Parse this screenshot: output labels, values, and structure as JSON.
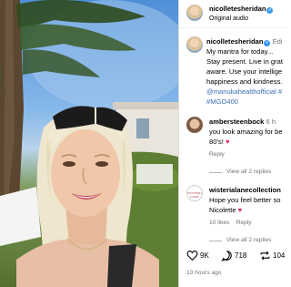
{
  "post": {
    "author": "nicolletesheridan",
    "audio": "Original audio"
  },
  "caption": {
    "author": "nicolletesheridan",
    "follow_label": "Edi",
    "lines": [
      "My mantra for today...",
      "Stay present. Live in grat",
      "aware. Use your intellige",
      "happiness and kindness."
    ],
    "mention": "@manukahealthofficial #",
    "hashtag": "#MGO400"
  },
  "comments": [
    {
      "user": "ambersteenbock",
      "time": "6 h",
      "text_lines": [
        "you look amazing for be",
        "80's!"
      ],
      "emoji": "♥",
      "reply_label": "Reply",
      "view_replies": "View all 2 replies"
    },
    {
      "user": "wisterialanecollection",
      "avatar_text": "WISTERIA LANE",
      "text_lines": [
        "Hope you feel better so",
        "Nicolette"
      ],
      "emoji": "♥",
      "likes": "10 likes",
      "reply_label": "Reply",
      "view_replies": "View all 2 replies"
    }
  ],
  "actions": {
    "likes": "9K",
    "comments": "718",
    "reposts": "104"
  },
  "timestamp": "10 hours ago",
  "colors": {
    "link": "#3b6fb6",
    "verified": "#3897f0",
    "heart": "#e0245e",
    "muted": "#737373"
  }
}
